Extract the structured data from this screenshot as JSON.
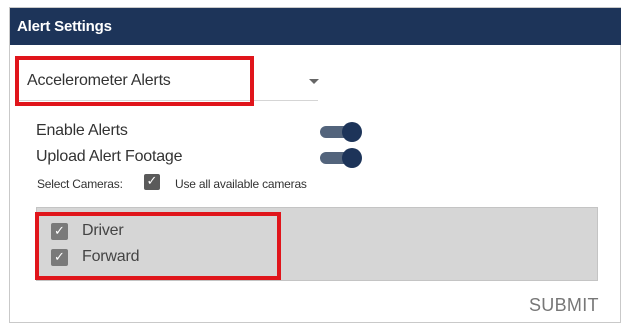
{
  "header": {
    "title": "Alert Settings"
  },
  "alert_type": {
    "selected": "Accelerometer Alerts",
    "arrow_icon": "caret-down-icon"
  },
  "settings": {
    "enable_alerts": {
      "label": "Enable Alerts",
      "on": true
    },
    "upload_footage": {
      "label": "Upload Alert Footage",
      "on": true
    }
  },
  "select_cameras": {
    "label": "Select Cameras:",
    "use_all_label": "Use all available cameras",
    "use_all_checked": true
  },
  "cameras": [
    {
      "label": "Driver",
      "checked": true
    },
    {
      "label": "Forward",
      "checked": true
    }
  ],
  "actions": {
    "submit_label": "SUBMIT"
  },
  "colors": {
    "header_bg": "#1d3459",
    "highlight": "#e0151b",
    "toggle": "#1d3459"
  }
}
